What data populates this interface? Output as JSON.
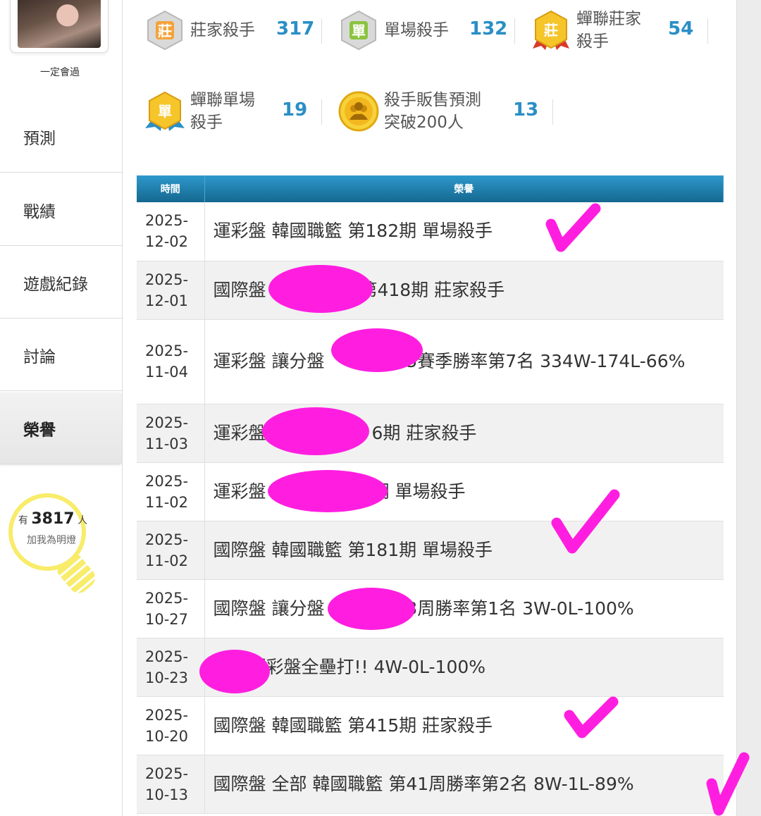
{
  "sidebar": {
    "nickname": "一定會過",
    "nav": [
      {
        "label": "預測"
      },
      {
        "label": "戰績"
      },
      {
        "label": "遊戲紀錄"
      },
      {
        "label": "討論"
      },
      {
        "label": "榮譽"
      }
    ],
    "bulb": {
      "prefix": "有",
      "count": "3817",
      "suffix": "人",
      "sub": "加我為明燈"
    }
  },
  "badges": [
    {
      "icon": "zhuang-badge-icon",
      "glyph": "莊",
      "label": "莊家殺手",
      "count": "317"
    },
    {
      "icon": "dan-badge-icon",
      "glyph": "單",
      "label": "單場殺手",
      "count": "132"
    },
    {
      "icon": "chanlian-zhuang-badge-icon",
      "glyph": "莊",
      "label_line1": "蟬聯莊家",
      "label_line2": "殺手",
      "count": "54"
    },
    {
      "icon": "chanlian-dan-badge-icon",
      "glyph": "單",
      "label_line1": "蟬聯單場",
      "label_line2": "殺手",
      "count": "19"
    },
    {
      "icon": "sales-medal-icon",
      "label_line1": "殺手販售預測",
      "label_line2": "突破200人",
      "count": "13"
    }
  ],
  "table": {
    "headers": [
      "時間",
      "榮譽"
    ],
    "rows": [
      {
        "date_y": "2025-",
        "date_md": "12-02",
        "text": "運彩盤 韓國職籃 第182期 單場殺手"
      },
      {
        "date_y": "2025-",
        "date_md": "12-01",
        "text": "國際盤 　　　　　第418期 莊家殺手"
      },
      {
        "date_y": "2025-",
        "date_md": "11-04",
        "text": "運彩盤 讓分盤　　　　25賽季勝率第7名 334W-174L-66%"
      },
      {
        "date_y": "2025-",
        "date_md": "11-03",
        "text": "運彩盤　　　　　　6期 莊家殺手"
      },
      {
        "date_y": "2025-",
        "date_md": "11-02",
        "text": "運彩盤　　　　　　期 單場殺手"
      },
      {
        "date_y": "2025-",
        "date_md": "11-02",
        "text": "國際盤 韓國職籃 第181期 單場殺手"
      },
      {
        "date_y": "2025-",
        "date_md": "10-27",
        "text": "國際盤 讓分盤　　　　43周勝率第1名 3W-0L-100%"
      },
      {
        "date_y": "2025-",
        "date_md": "10-23",
        "text": "　　運彩盤全壘打!! 4W-0L-100%"
      },
      {
        "date_y": "2025-",
        "date_md": "10-20",
        "text": "國際盤 韓國職籃 第415期 莊家殺手"
      },
      {
        "date_y": "2025-",
        "date_md": "10-13",
        "text": "國際盤 全部 韓國職籃 第41周勝率第2名 8W-1L-89%"
      }
    ]
  },
  "colors": {
    "accent": "#2a8fc6",
    "header": "#1a7aab",
    "marker": "#ff1ee0",
    "bulb": "#f8ec6a"
  }
}
